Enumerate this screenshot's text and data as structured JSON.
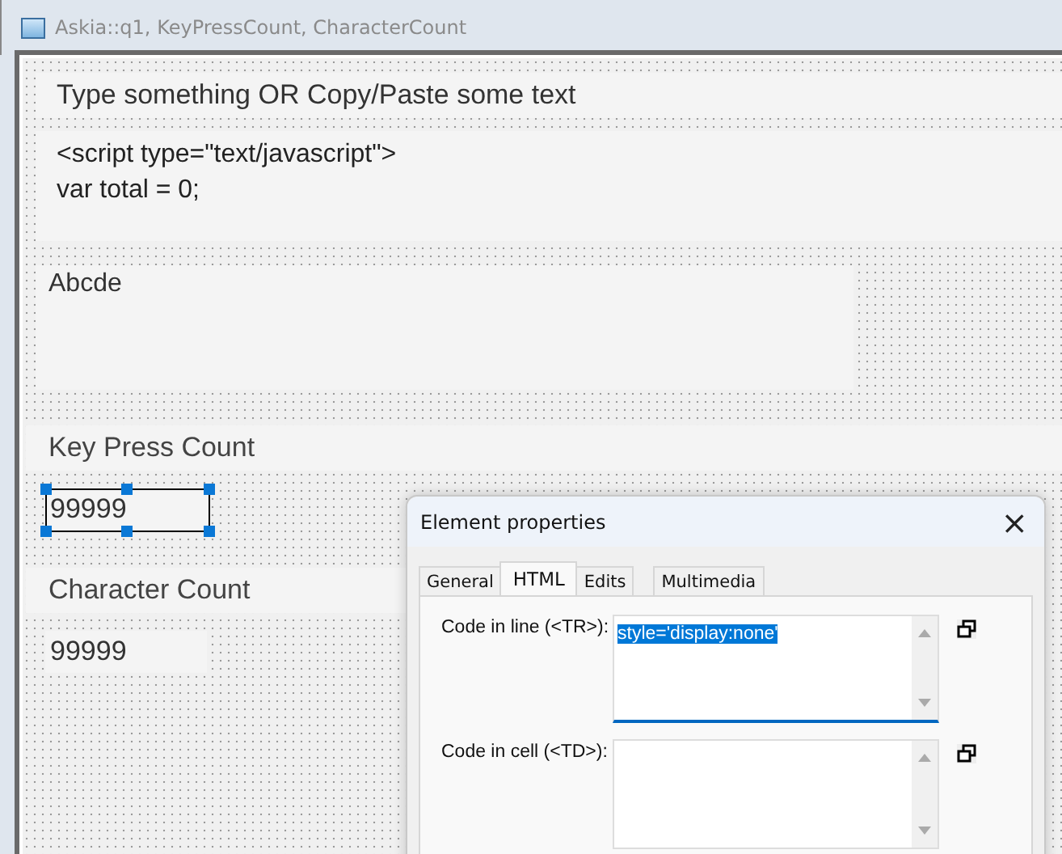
{
  "window": {
    "title": "Askia::q1, KeyPressCount, CharacterCount"
  },
  "canvas": {
    "prompt": "Type something OR Copy/Paste some text",
    "script_lines": [
      "<script type=\"text/javascript\">",
      "var total = 0;"
    ],
    "answer": "Abcde",
    "counters": [
      {
        "label": "Key Press Count",
        "value": "99999",
        "selected": true
      },
      {
        "label": "Character Count",
        "value": "99999",
        "selected": false
      }
    ]
  },
  "dialog": {
    "title": "Element properties",
    "close": "×",
    "tabs": [
      {
        "label": "General",
        "selected": false
      },
      {
        "label": "HTML",
        "selected": true
      },
      {
        "label": "Edits",
        "selected": false
      },
      {
        "label": "Multimedia",
        "selected": false
      }
    ],
    "fields": [
      {
        "label": "Code in line (<TR>):",
        "value": "style='display:none'",
        "focused": true
      },
      {
        "label": "Code in cell (<TD>):",
        "focused": false
      }
    ]
  }
}
